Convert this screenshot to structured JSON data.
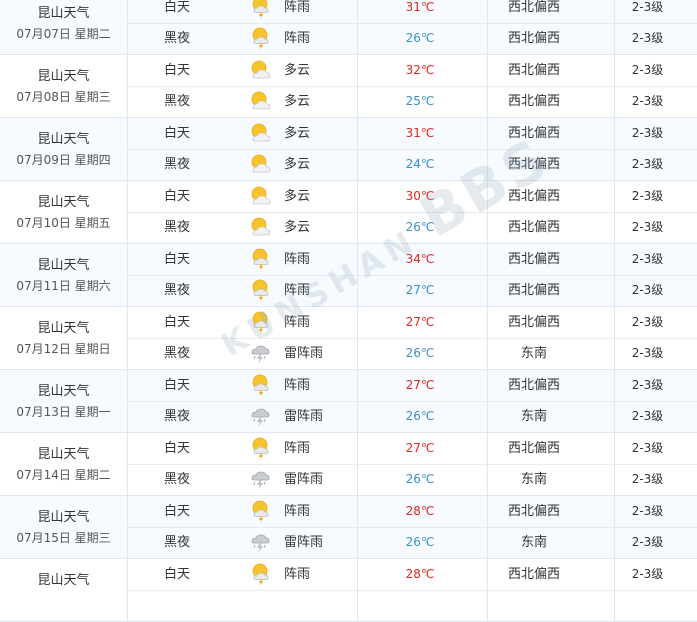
{
  "colors": {
    "hot": "#e0281e",
    "cool": "#3b8ec8",
    "row_alt": "#f7fbff",
    "border": "#dfe6ec"
  },
  "days": [
    {
      "city": "昆山天气",
      "date": "07月07日 星期二",
      "day": {
        "period": "白天",
        "icon": "thundershower-icon",
        "weather": "阵雨",
        "temp": "31℃",
        "wind": "西北偏西",
        "level": "2-3级"
      },
      "night": {
        "period": "黑夜",
        "icon": "thundershower-icon",
        "weather": "阵雨",
        "temp": "26℃",
        "wind": "西北偏西",
        "level": "2-3级"
      }
    },
    {
      "city": "昆山天气",
      "date": "07月08日 星期三",
      "day": {
        "period": "白天",
        "icon": "partly-cloudy-icon",
        "weather": "多云",
        "temp": "32℃",
        "wind": "西北偏西",
        "level": "2-3级"
      },
      "night": {
        "period": "黑夜",
        "icon": "partly-cloudy-icon",
        "weather": "多云",
        "temp": "25℃",
        "wind": "西北偏西",
        "level": "2-3级"
      }
    },
    {
      "city": "昆山天气",
      "date": "07月09日 星期四",
      "day": {
        "period": "白天",
        "icon": "partly-cloudy-icon",
        "weather": "多云",
        "temp": "31℃",
        "wind": "西北偏西",
        "level": "2-3级"
      },
      "night": {
        "period": "黑夜",
        "icon": "partly-cloudy-icon",
        "weather": "多云",
        "temp": "24℃",
        "wind": "西北偏西",
        "level": "2-3级"
      }
    },
    {
      "city": "昆山天气",
      "date": "07月10日 星期五",
      "day": {
        "period": "白天",
        "icon": "partly-cloudy-icon",
        "weather": "多云",
        "temp": "30℃",
        "wind": "西北偏西",
        "level": "2-3级"
      },
      "night": {
        "period": "黑夜",
        "icon": "partly-cloudy-icon",
        "weather": "多云",
        "temp": "26℃",
        "wind": "西北偏西",
        "level": "2-3级"
      }
    },
    {
      "city": "昆山天气",
      "date": "07月11日 星期六",
      "day": {
        "period": "白天",
        "icon": "thundershower-icon",
        "weather": "阵雨",
        "temp": "34℃",
        "wind": "西北偏西",
        "level": "2-3级"
      },
      "night": {
        "period": "黑夜",
        "icon": "thundershower-icon",
        "weather": "阵雨",
        "temp": "27℃",
        "wind": "西北偏西",
        "level": "2-3级"
      }
    },
    {
      "city": "昆山天气",
      "date": "07月12日 星期日",
      "day": {
        "period": "白天",
        "icon": "thundershower-icon",
        "weather": "阵雨",
        "temp": "27℃",
        "wind": "西北偏西",
        "level": "2-3级"
      },
      "night": {
        "period": "黑夜",
        "icon": "thunderstorm-icon",
        "weather": "雷阵雨",
        "temp": "26℃",
        "wind": "东南",
        "level": "2-3级"
      }
    },
    {
      "city": "昆山天气",
      "date": "07月13日 星期一",
      "day": {
        "period": "白天",
        "icon": "thundershower-icon",
        "weather": "阵雨",
        "temp": "27℃",
        "wind": "西北偏西",
        "level": "2-3级"
      },
      "night": {
        "period": "黑夜",
        "icon": "thunderstorm-icon",
        "weather": "雷阵雨",
        "temp": "26℃",
        "wind": "东南",
        "level": "2-3级"
      }
    },
    {
      "city": "昆山天气",
      "date": "07月14日 星期二",
      "day": {
        "period": "白天",
        "icon": "thundershower-icon",
        "weather": "阵雨",
        "temp": "27℃",
        "wind": "西北偏西",
        "level": "2-3级"
      },
      "night": {
        "period": "黑夜",
        "icon": "thunderstorm-icon",
        "weather": "雷阵雨",
        "temp": "26℃",
        "wind": "东南",
        "level": "2-3级"
      }
    },
    {
      "city": "昆山天气",
      "date": "07月15日 星期三",
      "day": {
        "period": "白天",
        "icon": "thundershower-icon",
        "weather": "阵雨",
        "temp": "28℃",
        "wind": "西北偏西",
        "level": "2-3级"
      },
      "night": {
        "period": "黑夜",
        "icon": "thunderstorm-icon",
        "weather": "雷阵雨",
        "temp": "26℃",
        "wind": "东南",
        "level": "2-3级"
      }
    },
    {
      "city": "昆山天气",
      "date": "",
      "day": {
        "period": "白天",
        "icon": "thundershower-icon",
        "weather": "阵雨",
        "temp": "28℃",
        "wind": "西北偏西",
        "level": "2-3级"
      },
      "night": {
        "period": "",
        "icon": "",
        "weather": "",
        "temp": "",
        "wind": "",
        "level": ""
      }
    }
  ],
  "watermark": {
    "line1": "KUNSHAN",
    "line2": "BBS"
  }
}
